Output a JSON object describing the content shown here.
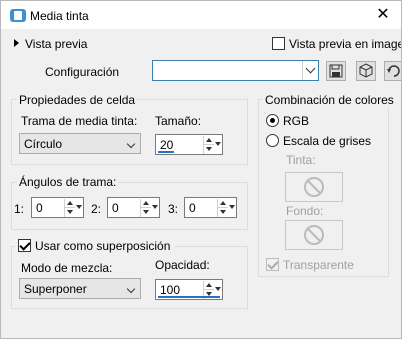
{
  "window": {
    "title": "Media tinta",
    "close_label": "✕"
  },
  "preview": {
    "label": "Vista previa",
    "image_preview_label": "Vista previa en imagen",
    "image_preview_checked": false
  },
  "config": {
    "label": "Configuración",
    "value": ""
  },
  "cell": {
    "title": "Propiedades de celda",
    "screen_label": "Trama de media tinta:",
    "screen_value": "Círculo",
    "size_label": "Tamaño:",
    "size_value": "20"
  },
  "angles": {
    "title": "Ángulos de trama:",
    "items": [
      {
        "label": "1:",
        "value": "0"
      },
      {
        "label": "2:",
        "value": "0"
      },
      {
        "label": "3:",
        "value": "0"
      }
    ]
  },
  "overlay": {
    "label": "Usar como superposición",
    "checked": true,
    "blend_label": "Modo de mezcla:",
    "blend_value": "Superponer",
    "opacity_label": "Opacidad:",
    "opacity_value": "100"
  },
  "colors": {
    "title": "Combinación de colores",
    "rgb_label": "RGB",
    "gray_label": "Escala de grises",
    "selected": "RGB",
    "ink_label": "Tinta:",
    "bg_label": "Fondo:",
    "transparent_label": "Transparente",
    "transparent_checked": true
  }
}
